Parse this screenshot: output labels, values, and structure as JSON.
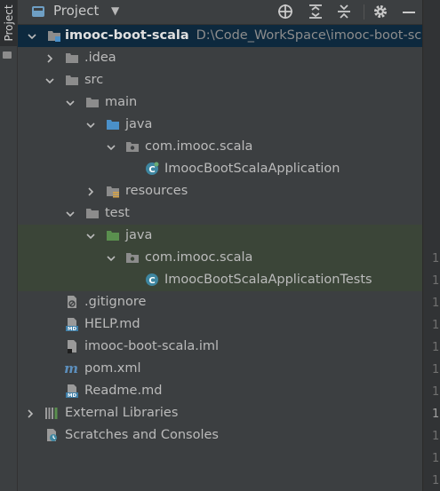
{
  "side_strip": {
    "tab_label": "Project"
  },
  "header": {
    "title": "Project",
    "buttons": [
      "crosshair-icon",
      "expand-all-icon",
      "collapse-all-icon",
      "gear-icon",
      "minimize-icon"
    ]
  },
  "tree": {
    "root": {
      "name": "imooc-boot-scala",
      "path": "D:\\Code_WorkSpace\\imooc-boot-sc"
    },
    "idea": {
      "name": ".idea"
    },
    "src": {
      "name": "src"
    },
    "main": {
      "name": "main"
    },
    "main_java": {
      "name": "java"
    },
    "main_pkg": {
      "name": "com.imooc.scala"
    },
    "main_class": {
      "name": "ImoocBootScalaApplication"
    },
    "resources": {
      "name": "resources"
    },
    "test": {
      "name": "test"
    },
    "test_java": {
      "name": "java"
    },
    "test_pkg": {
      "name": "com.imooc.scala"
    },
    "test_class": {
      "name": "ImoocBootScalaApplicationTests"
    },
    "gitignore": {
      "name": ".gitignore"
    },
    "help": {
      "name": "HELP.md"
    },
    "iml": {
      "name": "imooc-boot-scala.iml"
    },
    "pom": {
      "name": "pom.xml"
    },
    "readme": {
      "name": "Readme.md"
    },
    "ext_libs": {
      "name": "External Libraries"
    },
    "scratches": {
      "name": "Scratches and Consoles"
    }
  },
  "colors": {
    "selection": "#0d293e",
    "test_highlight": "#3b4538",
    "source_folder": "#4a90c9",
    "test_folder": "#5a8f4e",
    "plain_folder": "#8c8c8c"
  },
  "right_gutter": {
    "visible_digit": "1"
  }
}
